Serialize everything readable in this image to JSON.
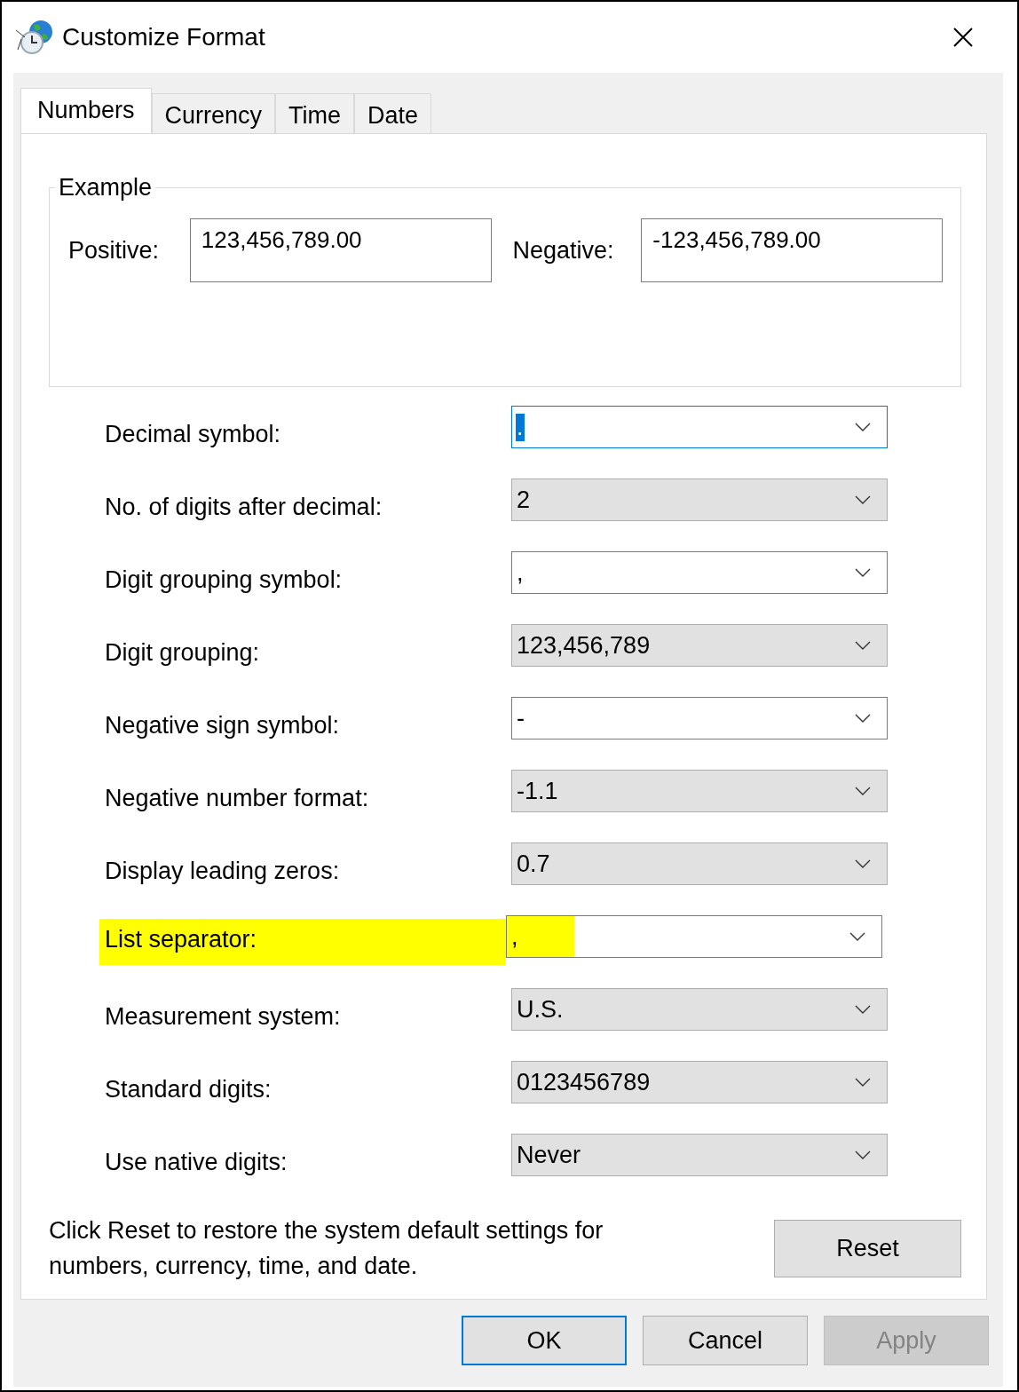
{
  "window": {
    "title": "Customize Format"
  },
  "tabs": [
    {
      "label": "Numbers",
      "selected": true
    },
    {
      "label": "Currency",
      "selected": false
    },
    {
      "label": "Time",
      "selected": false
    },
    {
      "label": "Date",
      "selected": false
    }
  ],
  "example": {
    "title": "Example",
    "positive_label": "Positive:",
    "positive_value": "123,456,789.00",
    "negative_label": "Negative:",
    "negative_value": "-123,456,789.00"
  },
  "settings": [
    {
      "label": "Decimal symbol:",
      "value": ".",
      "kind": "editable",
      "focused": true,
      "highlighted": false
    },
    {
      "label": "No. of digits after decimal:",
      "value": "2",
      "kind": "list",
      "focused": false,
      "highlighted": false
    },
    {
      "label": "Digit grouping symbol:",
      "value": ",",
      "kind": "editable",
      "focused": false,
      "highlighted": false
    },
    {
      "label": "Digit grouping:",
      "value": "123,456,789",
      "kind": "list",
      "focused": false,
      "highlighted": false
    },
    {
      "label": "Negative sign symbol:",
      "value": "-",
      "kind": "editable",
      "focused": false,
      "highlighted": false
    },
    {
      "label": "Negative number format:",
      "value": "-1.1",
      "kind": "list",
      "focused": false,
      "highlighted": false
    },
    {
      "label": "Display leading zeros:",
      "value": "0.7",
      "kind": "list",
      "focused": false,
      "highlighted": false
    },
    {
      "label": "List separator:",
      "value": ",",
      "kind": "editable",
      "focused": false,
      "highlighted": true
    },
    {
      "label": "Measurement system:",
      "value": "U.S.",
      "kind": "list",
      "focused": false,
      "highlighted": false
    },
    {
      "label": "Standard digits:",
      "value": "0123456789",
      "kind": "list",
      "focused": false,
      "highlighted": false
    },
    {
      "label": "Use native digits:",
      "value": "Never",
      "kind": "list",
      "focused": false,
      "highlighted": false
    }
  ],
  "reset": {
    "text": "Click Reset to restore the system default settings for numbers, currency, time, and date.",
    "button": "Reset"
  },
  "buttons": [
    {
      "label": "OK",
      "default": true,
      "disabled": false
    },
    {
      "label": "Cancel",
      "default": false,
      "disabled": false
    },
    {
      "label": "Apply",
      "default": false,
      "disabled": true
    }
  ]
}
